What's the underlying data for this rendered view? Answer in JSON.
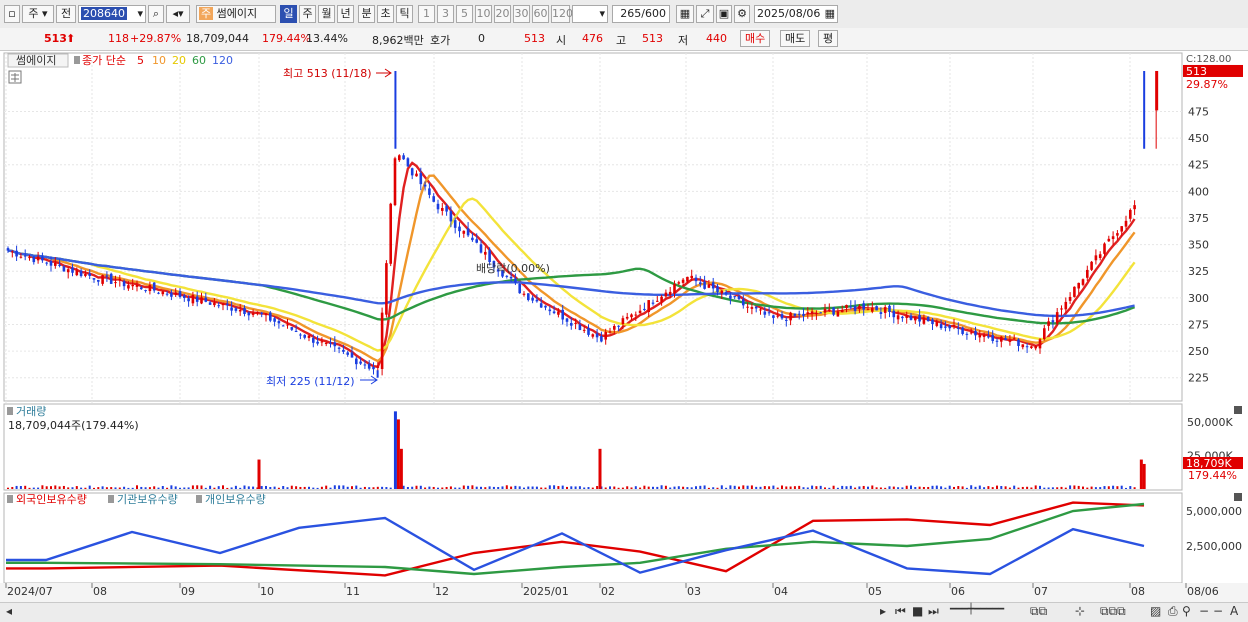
{
  "toolbar": {
    "type_label": "주",
    "prev_label": "전",
    "code": "208640",
    "stock_badge": "주",
    "stock_name": "썸에이지",
    "periods": [
      "일",
      "주",
      "월",
      "년",
      "분",
      "초",
      "틱"
    ],
    "active_period": "일",
    "intervals": [
      "1",
      "3",
      "5",
      "10",
      "20",
      "30",
      "60",
      "120"
    ],
    "count": "265",
    "count_total": "/600",
    "date": "2025/08/06"
  },
  "quote": {
    "price": "513",
    "change": "118",
    "change_pct": "+29.87%",
    "volume": "18,709,044",
    "volume_ratio": "179.44%",
    "turnover": "13.44%",
    "trade_value": "8,962백만",
    "bid_label": "호가",
    "bid_value": "0",
    "bid_price": "513",
    "open_label": "시",
    "open": "476",
    "high_label": "고",
    "high": "513",
    "low_label": "저",
    "low": "440",
    "buy_label": "매수",
    "sell_label": "매도",
    "eval_label": "평"
  },
  "legend": {
    "name": "썸에이지",
    "ma_label": "종가 단순",
    "ma5": "5",
    "ma10": "10",
    "ma20": "20",
    "ma60": "60",
    "ma120": "120"
  },
  "annotations": {
    "high": "최고 513 (11/18)",
    "low": "최저 225 (11/12)",
    "dividend": "배당락(0.00%)"
  },
  "volume_panel": {
    "title": "거래량",
    "current": "18,709,044주(179.44%)",
    "axis_ticks": [
      "50,000K",
      "25,000K"
    ],
    "current_badge": "18,709K",
    "current_pct": "179.44%"
  },
  "holding_panel": {
    "series": [
      "외국인보유수량",
      "기관보유수량",
      "개인보유수량"
    ],
    "axis_ticks": [
      "5,000,000",
      "2,500,000"
    ]
  },
  "x_labels": [
    "2024/07",
    "08",
    "09",
    "10",
    "11",
    "12",
    "2025/01",
    "02",
    "03",
    "04",
    "05",
    "06",
    "07",
    "08",
    "08/06"
  ],
  "price_axis": {
    "ticks": [
      "475",
      "450",
      "425",
      "400",
      "375",
      "350",
      "325",
      "300",
      "275",
      "250",
      "225"
    ],
    "top_label": "C:128.00",
    "current_badge": "513",
    "current_pct": "29.87%"
  },
  "chart_data": [
    {
      "type": "candlestick",
      "title": "썸에이지",
      "x_start": "2024/07",
      "x_end": "2025/08/06",
      "ylim": [
        205,
        528
      ],
      "key_points": [
        {
          "date": "2024/07",
          "close": 345
        },
        {
          "date": "2024/08",
          "close": 320
        },
        {
          "date": "2024/09",
          "close": 302
        },
        {
          "date": "2024/10",
          "close": 285
        },
        {
          "date": "2024/11/12",
          "close": 232,
          "low": 225
        },
        {
          "date": "2024/11/18",
          "close": 440,
          "high": 513
        },
        {
          "date": "2024/12",
          "close": 390
        },
        {
          "date": "2025/01",
          "close": 305
        },
        {
          "date": "2025/02",
          "close": 262
        },
        {
          "date": "2025/03",
          "close": 320
        },
        {
          "date": "2025/04",
          "close": 280
        },
        {
          "date": "2025/05",
          "close": 292
        },
        {
          "date": "2025/06",
          "close": 272
        },
        {
          "date": "2025/07",
          "close": 255
        },
        {
          "date": "2025/08/05",
          "close": 395
        },
        {
          "date": "2025/08/06",
          "open": 476,
          "high": 513,
          "low": 440,
          "close": 513
        }
      ],
      "series": [
        {
          "name": "5",
          "color": "#e02020"
        },
        {
          "name": "10",
          "color": "#f0962a"
        },
        {
          "name": "20",
          "color": "#f3e33a"
        },
        {
          "name": "60",
          "color": "#2e9a43"
        },
        {
          "name": "120",
          "color": "#3a5ee0"
        }
      ]
    },
    {
      "type": "bar",
      "title": "거래량",
      "unit": "K",
      "ylim": [
        0,
        62000
      ],
      "spikes": [
        {
          "date": "2024/10",
          "value": 22000
        },
        {
          "date": "2024/11/18",
          "value": 58000
        },
        {
          "date": "2024/11/19",
          "value": 52000
        },
        {
          "date": "2024/11/20",
          "value": 30000
        },
        {
          "date": "2025/02",
          "value": 30000
        },
        {
          "date": "2025/08/05",
          "value": 22000
        },
        {
          "date": "2025/08/06",
          "value": 18709
        }
      ]
    },
    {
      "type": "line",
      "ylim": [
        0,
        6000000
      ],
      "series": [
        {
          "name": "외국인보유수량",
          "color": "#e00000",
          "points": [
            [
              "2024/07",
              900000
            ],
            [
              "2024/09",
              1100000
            ],
            [
              "2024/11",
              400000
            ],
            [
              "2024/12",
              2000000
            ],
            [
              "2025/01",
              2800000
            ],
            [
              "2025/02",
              2100000
            ],
            [
              "2025/03",
              700000
            ],
            [
              "2025/04",
              4300000
            ],
            [
              "2025/05",
              4400000
            ],
            [
              "2025/06",
              4000000
            ],
            [
              "2025/07",
              5600000
            ],
            [
              "2025/08",
              5400000
            ]
          ]
        },
        {
          "name": "기관보유수량",
          "color": "#2e9a43",
          "points": [
            [
              "2024/07",
              1300000
            ],
            [
              "2024/09",
              1200000
            ],
            [
              "2024/11",
              1000000
            ],
            [
              "2024/12",
              500000
            ],
            [
              "2025/01",
              1000000
            ],
            [
              "2025/02",
              1300000
            ],
            [
              "2025/03",
              2300000
            ],
            [
              "2025/04",
              2800000
            ],
            [
              "2025/05",
              2500000
            ],
            [
              "2025/06",
              3000000
            ],
            [
              "2025/07",
              5000000
            ],
            [
              "2025/08",
              5500000
            ]
          ]
        },
        {
          "name": "개인보유수량",
          "color": "#2a52e0",
          "points": [
            [
              "2024/07",
              1500000
            ],
            [
              "2024/08",
              3500000
            ],
            [
              "2024/09",
              2000000
            ],
            [
              "2024/10",
              3800000
            ],
            [
              "2024/11",
              4500000
            ],
            [
              "2024/12",
              800000
            ],
            [
              "2025/01",
              3400000
            ],
            [
              "2025/02",
              600000
            ],
            [
              "2025/03",
              2200000
            ],
            [
              "2025/04",
              3600000
            ],
            [
              "2025/05",
              900000
            ],
            [
              "2025/06",
              500000
            ],
            [
              "2025/07",
              3700000
            ],
            [
              "2025/08",
              2500000
            ]
          ]
        }
      ]
    }
  ]
}
